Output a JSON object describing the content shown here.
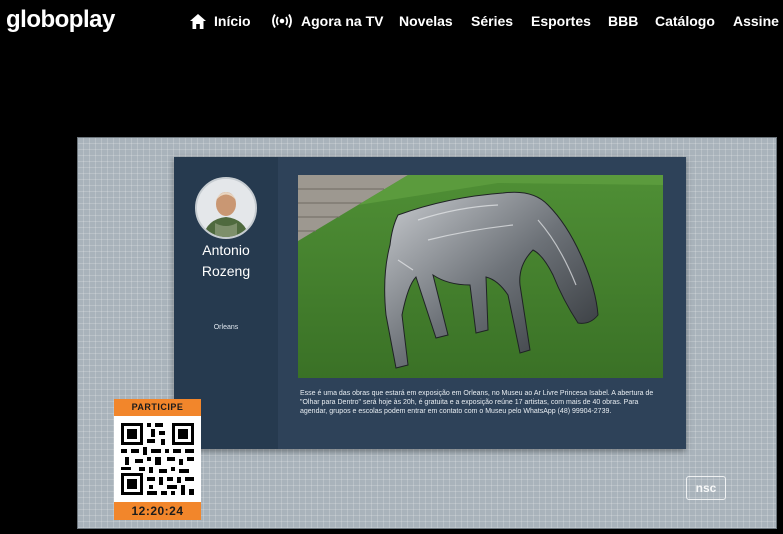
{
  "nav": {
    "logo": "globoplay",
    "items": [
      {
        "label": "Início",
        "icon": "home-icon"
      },
      {
        "label": "Agora na TV",
        "icon": "broadcast-icon"
      },
      {
        "label": "Novelas"
      },
      {
        "label": "Séries"
      },
      {
        "label": "Esportes"
      },
      {
        "label": "BBB"
      },
      {
        "label": "Catálogo"
      },
      {
        "label": "Assine"
      }
    ]
  },
  "video": {
    "card": {
      "author_first": "Antonio",
      "author_last": "Rozeng",
      "city": "Orleans",
      "caption": "Esse é uma das obras que estará em exposição em Orleans, no Museu ao Ar Livre Princesa Isabel. A abertura de \"Olhar para Dentro\" será hoje às 20h, é gratuita e a exposição reúne 17 artistas, com mais de 40 obras. Para agendar, grupos e escolas podem entrar em contato com o Museu pelo WhatsApp (48) 99904-2739."
    },
    "participe": {
      "label": "PARTICIPE",
      "time": "12:20:24"
    },
    "channel_logo": "nsc",
    "colors": {
      "accent_orange": "#f2862b",
      "panel": "#2e4259"
    }
  }
}
